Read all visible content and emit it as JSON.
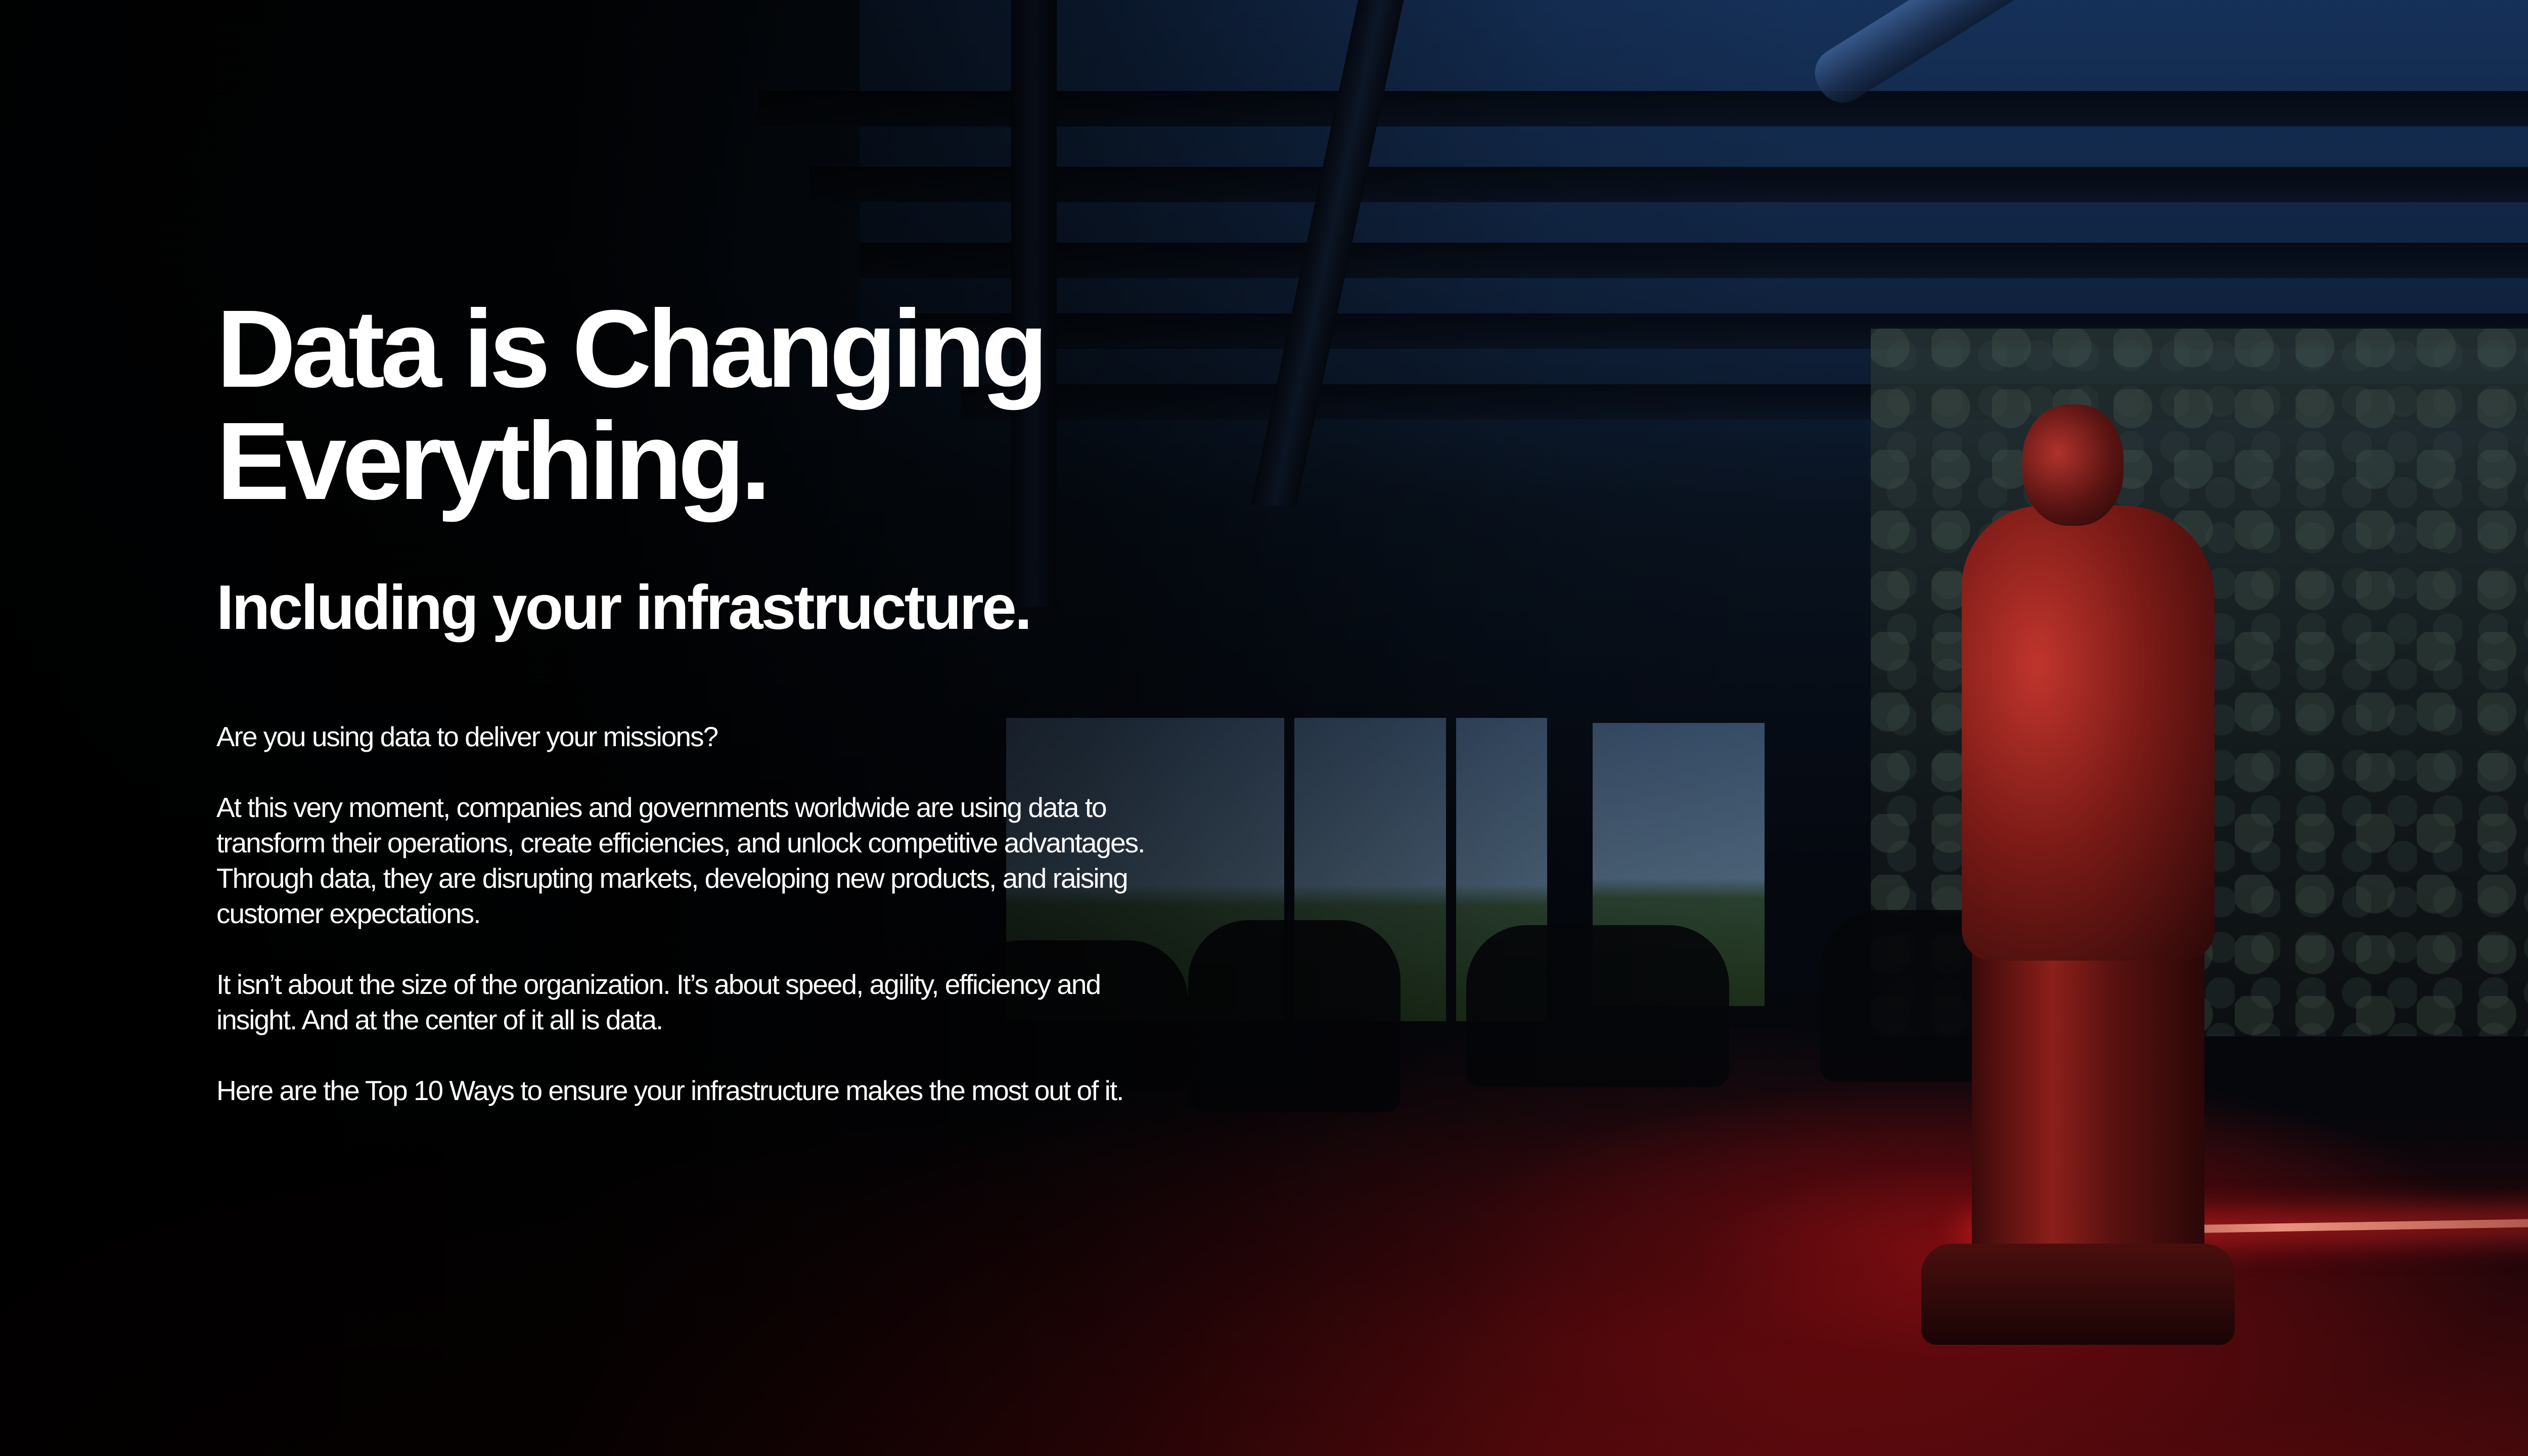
{
  "headline": {
    "line1": "Data is Changing",
    "line2": "Everything."
  },
  "subheadline": "Including your infrastructure.",
  "paragraphs": [
    "Are you using data to deliver your missions?",
    "At this very moment, companies and governments worldwide are using data to transform their operations, create efficiencies, and unlock competitive advantages. Through data, they are disrupting markets, developing new products, and raising customer expectations.",
    "It isn’t about the size of the organization. It’s about speed, agility, efficiency and insight. And at the center of it all is data.",
    "Here are the Top 10 Ways  to ensure your infrastructure makes the most out of it."
  ],
  "colors": {
    "text": "#ffffff",
    "accent_red": "#c0352d",
    "ceiling_blue": "#1c3052"
  }
}
